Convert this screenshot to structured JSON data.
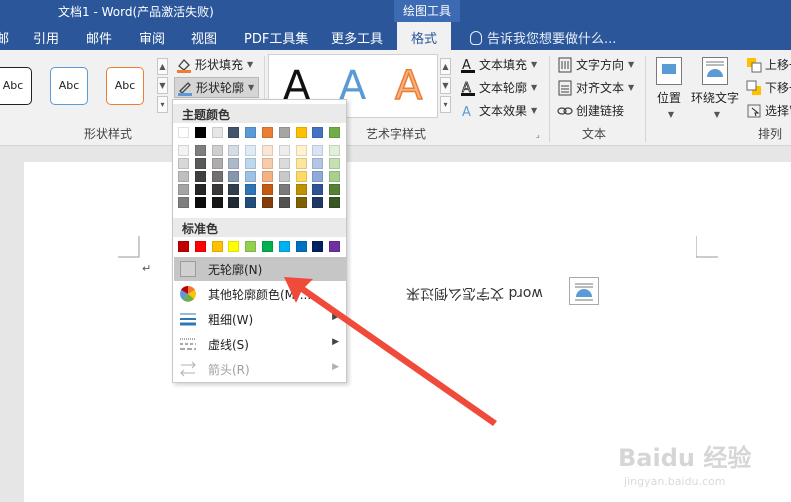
{
  "titlebar": {
    "title": "文档1 - Word(产品激活失败)",
    "tool_tab": "绘图工具"
  },
  "tabs": [
    {
      "label": "邮",
      "active": false
    },
    {
      "label": "引用",
      "active": false
    },
    {
      "label": "邮件",
      "active": false
    },
    {
      "label": "审阅",
      "active": false
    },
    {
      "label": "视图",
      "active": false
    },
    {
      "label": "PDF工具集",
      "active": false
    },
    {
      "label": "更多工具",
      "active": false
    },
    {
      "label": "格式",
      "active": true
    }
  ],
  "tellme": {
    "text": "告诉我您想要做什么..."
  },
  "ribbon": {
    "shape_styles": {
      "swatch_label": "Abc",
      "fill": "形状填充",
      "outline": "形状轮廓",
      "group_label": "形状样式"
    },
    "wordart": {
      "sample": "A",
      "text_fill": "文本填充",
      "text_outline": "文本轮廓",
      "text_effect": "文本效果",
      "group_label": "艺术字样式"
    },
    "text": {
      "direction": "文字方向",
      "align": "对齐文本",
      "link": "创建链接",
      "group_label": "文本"
    },
    "arrange": {
      "position": "位置",
      "wrap": "环绕文字",
      "bring_forward": "上移一",
      "send_backward": "下移一",
      "selection_pane": "选择窗",
      "group_label": "排列"
    }
  },
  "dropdown": {
    "theme_colors_title": "主题颜色",
    "standard_colors_title": "标准色",
    "theme_top_row": [
      "#ffffff",
      "#000000",
      "#e7e6e6",
      "#44546a",
      "#5b9bd5",
      "#ed7d31",
      "#a5a5a5",
      "#ffc000",
      "#4472c4",
      "#70ad47"
    ],
    "theme_shades": [
      [
        "#f2f2f2",
        "#7f7f7f",
        "#d0cece",
        "#d6dce4",
        "#deebf6",
        "#fbe5d5",
        "#ededed",
        "#fff2cc",
        "#dae3f3",
        "#e2efd9"
      ],
      [
        "#d8d8d8",
        "#595959",
        "#aeabab",
        "#adb9ca",
        "#bdd7ee",
        "#f7cbac",
        "#dbdbdb",
        "#fee599",
        "#b4c6e7",
        "#c5e0b3"
      ],
      [
        "#bfbfbf",
        "#3f3f3f",
        "#757070",
        "#8496b0",
        "#9cc3e5",
        "#f4b183",
        "#c9c9c9",
        "#ffd965",
        "#8eaadb",
        "#a8d08d"
      ],
      [
        "#a5a5a5",
        "#262626",
        "#3a3838",
        "#323f4f",
        "#2e75b5",
        "#c55a11",
        "#7b7b7b",
        "#bf9000",
        "#2f5496",
        "#538135"
      ],
      [
        "#7f7f7f",
        "#0c0c0c",
        "#171616",
        "#222a35",
        "#1e4e79",
        "#833c0b",
        "#525252",
        "#7f6000",
        "#1f3864",
        "#375623"
      ]
    ],
    "standard": [
      "#c00000",
      "#ff0000",
      "#ffc000",
      "#ffff00",
      "#92d050",
      "#00b050",
      "#00b0f0",
      "#0070c0",
      "#002060",
      "#7030a0"
    ],
    "items": {
      "no_outline": "无轮廓(N)",
      "more_colors": "其他轮廓颜色(M)...",
      "weight": "粗细(W)",
      "dashes": "虚线(S)",
      "arrows": "箭头(R)"
    }
  },
  "document": {
    "mirror_text": "word 文字怎么倒过来"
  },
  "watermark": {
    "brand": "Baidu 经验",
    "url": "jingyan.baidu.com"
  }
}
